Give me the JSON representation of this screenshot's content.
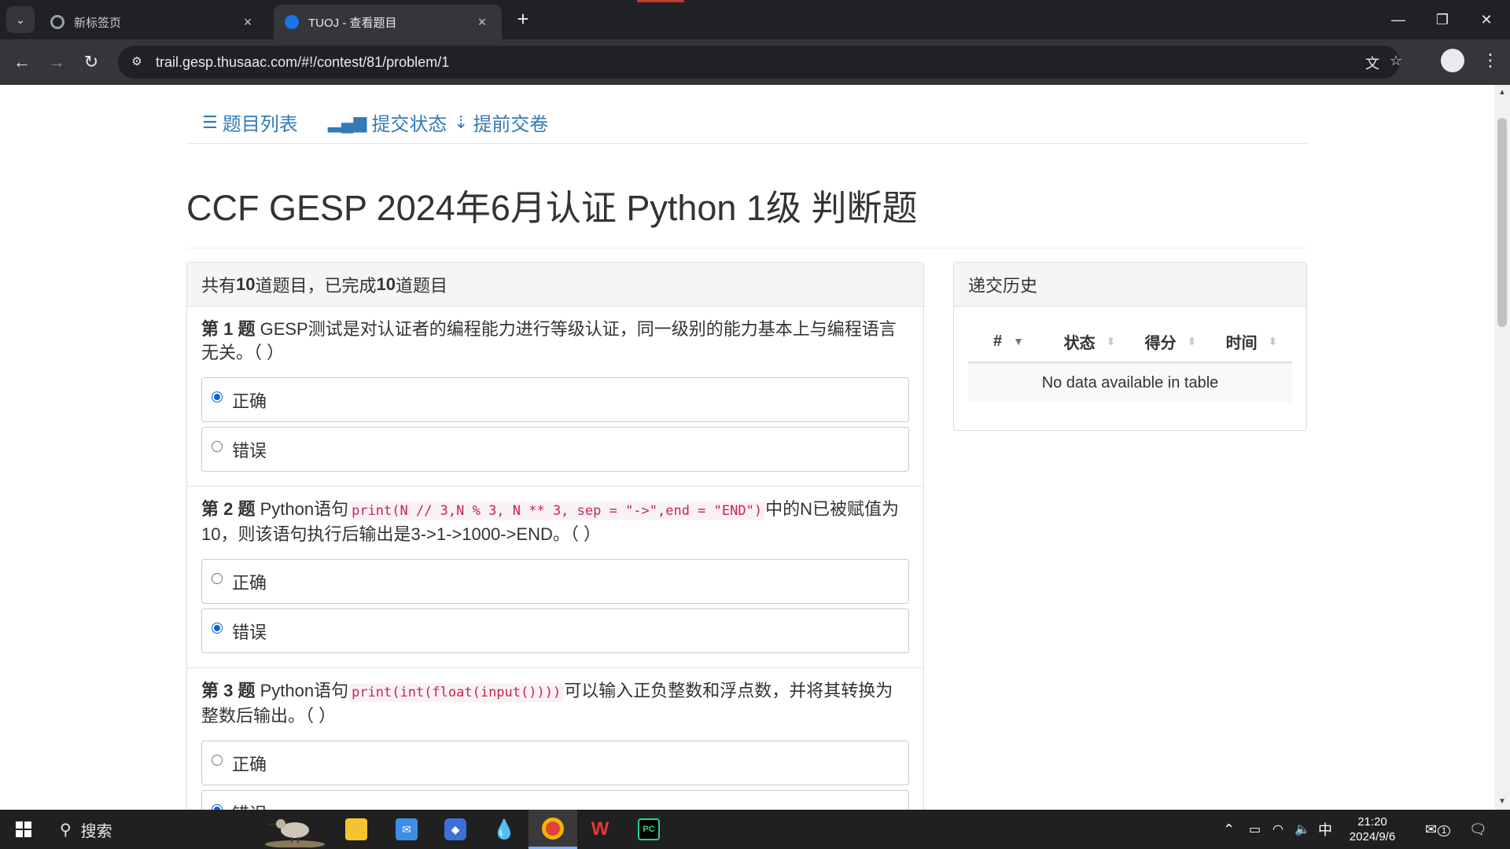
{
  "browser": {
    "tabs": [
      {
        "title": "新标签页",
        "close": "×"
      },
      {
        "title": "TUOJ - 查看题目",
        "close": "×"
      }
    ],
    "new_tab": "+",
    "url": "trail.gesp.thusaac.com/#!/contest/81/problem/1"
  },
  "nav": {
    "problem_list": "题目列表",
    "submit_status": "提交状态",
    "early_submit": "提前交卷"
  },
  "page_title": "CCF GESP 2024年6月认证 Python 1级 判断题",
  "summary": {
    "prefix": "共有 ",
    "total": "10",
    "middle": " 道题目，已完成 ",
    "done": "10",
    "suffix": " 道题目"
  },
  "questions": [
    {
      "label": "第 1 题",
      "text": " GESP测试是对认证者的编程能力进行等级认证，同一级别的能力基本上与编程语言无关。（ ）",
      "code": "",
      "text_after": "",
      "options": [
        {
          "label": "正确",
          "selected": true
        },
        {
          "label": "错误",
          "selected": false
        }
      ]
    },
    {
      "label": "第 2 题",
      "text": " Python语句",
      "code": "print(N // 3,N % 3, N ** 3, sep = \"->\",end = \"END\")",
      "text_after": "中的N已被赋值为10，则该语句执行后输出是3->1->1000->END。（ ）",
      "options": [
        {
          "label": "正确",
          "selected": false
        },
        {
          "label": "错误",
          "selected": true
        }
      ]
    },
    {
      "label": "第 3 题",
      "text": " Python语句",
      "code": "print(int(float(input())))",
      "text_after": "可以输入正负整数和浮点数，并将其转换为整数后输出。（ ）",
      "options": [
        {
          "label": "正确",
          "selected": false
        },
        {
          "label": "错误",
          "selected": true
        }
      ]
    }
  ],
  "history": {
    "title": "递交历史",
    "columns": [
      "#",
      "状态",
      "得分",
      "时间"
    ],
    "empty": "No data available in table"
  },
  "taskbar": {
    "search_label": "搜索",
    "ime": "中",
    "time": "21:20",
    "date": "2024/9/6",
    "notif_count": "1"
  }
}
